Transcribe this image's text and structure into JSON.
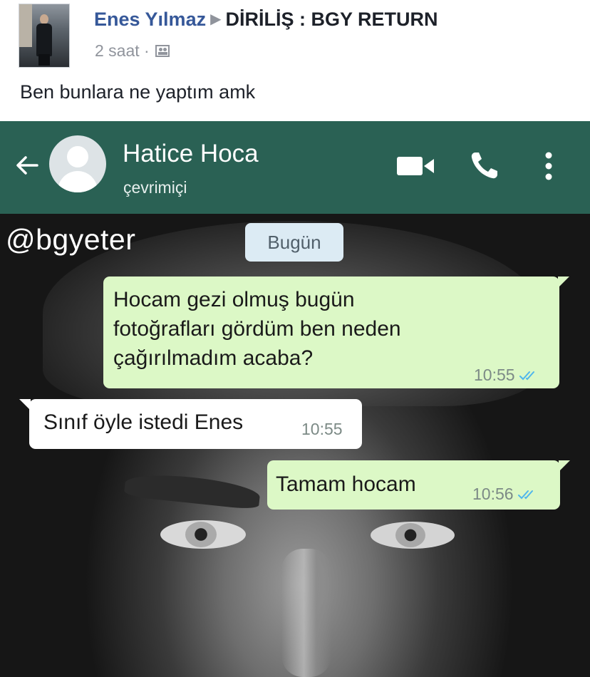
{
  "post": {
    "author": "Enes Yılmaz",
    "separator": "▶",
    "group": "DİRİLİŞ : BGY RETURN",
    "time": "2 saat",
    "dot": "·",
    "audience_icon": "friends-icon",
    "text": "Ben bunlara ne yaptım amk"
  },
  "chat": {
    "contact_name": "Hatice Hoca",
    "contact_status": "çevrimiçi",
    "watermark": "@bgyeter",
    "date_divider": "Bugün",
    "icons": [
      "back-arrow-icon",
      "contact-avatar-icon",
      "video-call-icon",
      "phone-icon",
      "more-vert-icon",
      "double-check-icon"
    ],
    "colors": {
      "header": "#2a6154",
      "outgoing_bubble": "#dcf8c6",
      "incoming_bubble": "#ffffff",
      "read_ticks": "#4fb6ec",
      "facebook_link": "#365899"
    },
    "messages": [
      {
        "direction": "outgoing",
        "text": "Hocam gezi olmuş bugün fotoğrafları gördüm ben neden çağırılmadım acaba?",
        "time": "10:55",
        "read": true
      },
      {
        "direction": "incoming",
        "text": "Sınıf öyle istedi Enes",
        "time": "10:55"
      },
      {
        "direction": "outgoing",
        "text": "Tamam hocam",
        "time": "10:56",
        "read": true
      }
    ]
  }
}
